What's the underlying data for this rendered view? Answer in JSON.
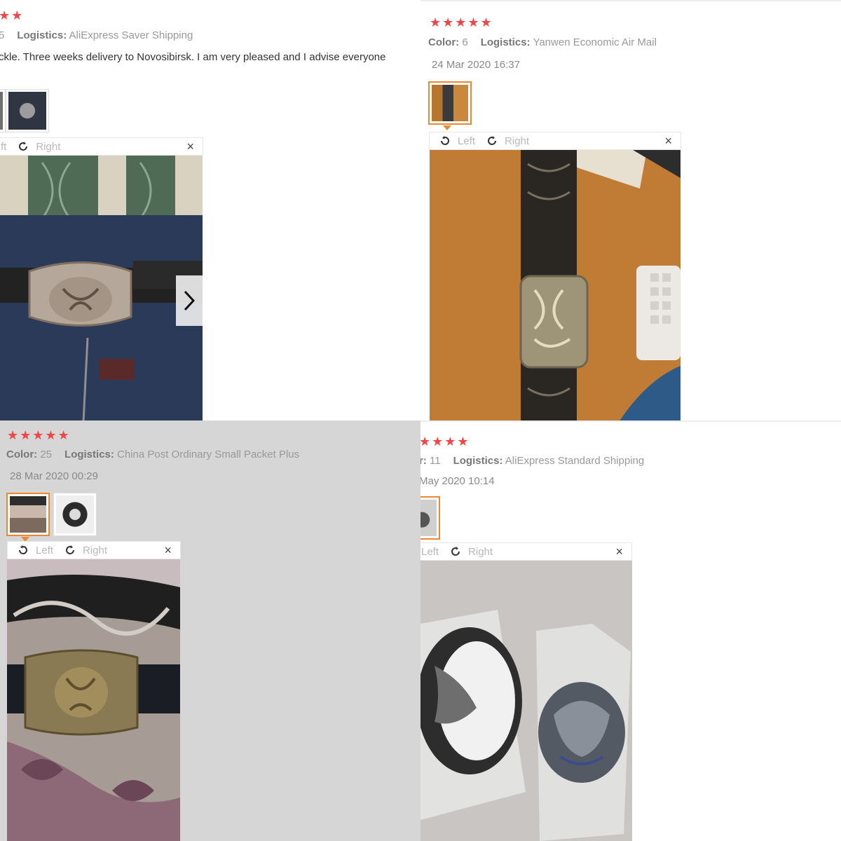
{
  "reviews": [
    {
      "stars": "★★",
      "color_label": "",
      "color_value": "5",
      "logistics_label": "Logistics:",
      "logistics_value": "AliExpress Saver Shipping",
      "feedback": "ckle. Three weeks delivery to Novosibirsk. I am very pleased and I advise everyone",
      "toolbar": {
        "left": "ft",
        "right": "Right",
        "close": "×"
      }
    },
    {
      "stars": "★★★★★",
      "color_label": "Color:",
      "color_value": "6",
      "logistics_label": "Logistics:",
      "logistics_value": "Yanwen Economic Air Mail",
      "date": "24 Mar 2020 16:37",
      "toolbar": {
        "left": "Left",
        "right": "Right",
        "close": "×"
      }
    },
    {
      "stars": "★★★★★",
      "color_label": "Color:",
      "color_value": "25",
      "logistics_label": "Logistics:",
      "logistics_value": "China Post Ordinary Small Packet Plus",
      "date": "28 Mar 2020 00:29",
      "toolbar": {
        "left": "Left",
        "right": "Right",
        "close": "×"
      }
    },
    {
      "stars": "★★★★",
      "color_label": "r:",
      "color_value": "11",
      "logistics_label": "Logistics:",
      "logistics_value": "AliExpress Standard Shipping",
      "date": "May 2020 10:14",
      "toolbar": {
        "left": "Left",
        "right": "Right",
        "close": "×"
      }
    }
  ],
  "icons": {
    "rotate_left": "rotate-left-icon",
    "rotate_right": "rotate-right-icon",
    "close": "close-icon",
    "next": "chevron-right-icon"
  },
  "colors": {
    "star": "#f04646",
    "active_thumb": "#e98a33",
    "label": "#777777",
    "value": "#999999"
  }
}
